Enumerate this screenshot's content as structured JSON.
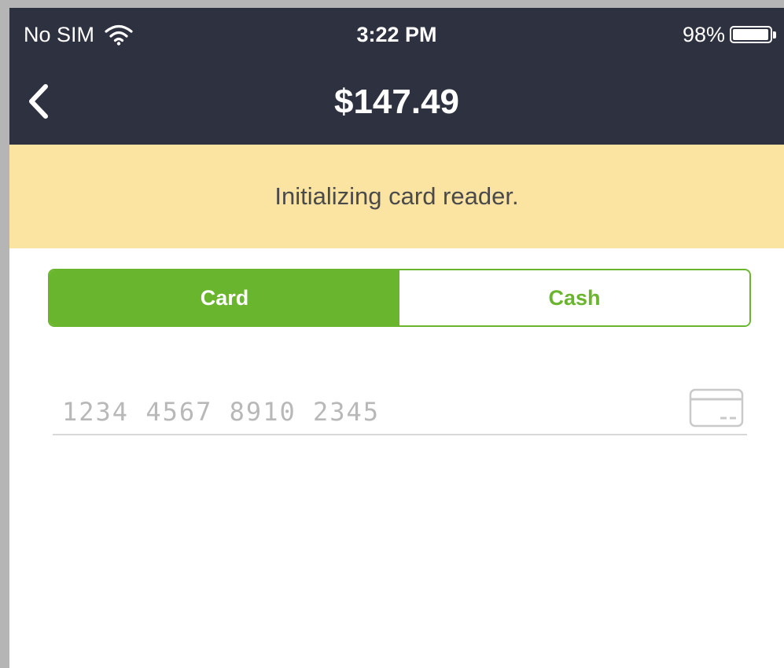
{
  "status_bar": {
    "carrier": "No SIM",
    "time": "3:22 PM",
    "battery_percent_label": "98%",
    "battery_level": 0.98,
    "wifi_icon": "wifi-icon",
    "battery_icon": "battery-icon"
  },
  "nav": {
    "back_icon": "chevron-left-icon",
    "title": "$147.49"
  },
  "banner": {
    "message": "Initializing card reader."
  },
  "payment_method": {
    "options": [
      "Card",
      "Cash"
    ],
    "selected": "Card"
  },
  "card_input": {
    "placeholder": "1234 4567 8910 2345",
    "value": "",
    "icon": "credit-card-icon"
  },
  "colors": {
    "nav_background": "#2e3140",
    "banner_background": "#fbe4a2",
    "accent_green": "#6ab52e"
  }
}
